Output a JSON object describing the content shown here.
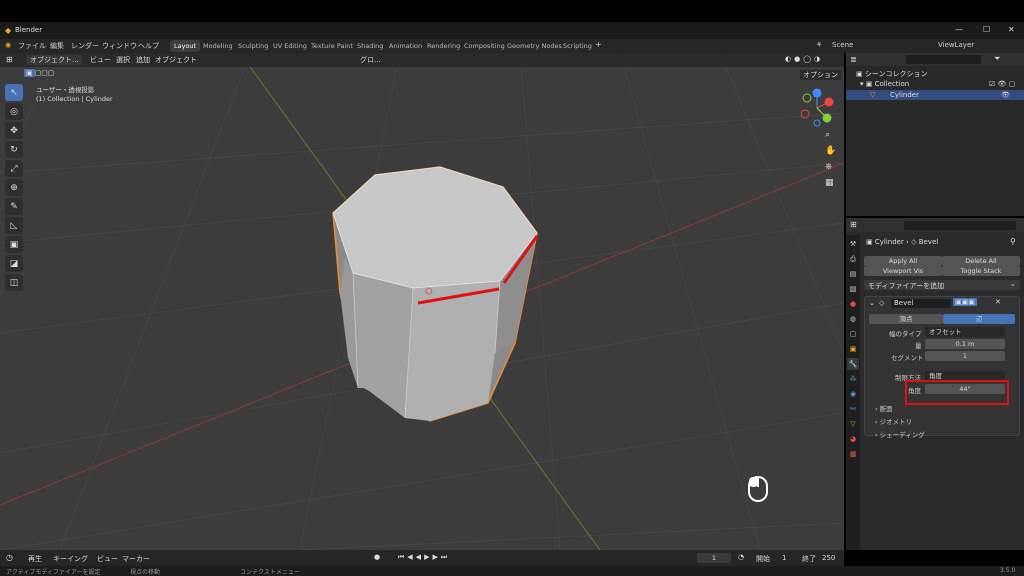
{
  "window": {
    "title": "Blender",
    "controls": [
      "—",
      "☐",
      "✕"
    ]
  },
  "menu": [
    "ファイル",
    "編集",
    "レンダー",
    "ウィンドウ",
    "ヘルプ"
  ],
  "workspaces": [
    "Layout",
    "Modeling",
    "Sculpting",
    "UV Editing",
    "Texture Paint",
    "Shading",
    "Animation",
    "Rendering",
    "Compositing",
    "Geometry Nodes",
    "Scripting"
  ],
  "scene": {
    "name": "Scene",
    "view_layer": "ViewLayer"
  },
  "viewport_header": {
    "mode": "オブジェクト...",
    "menus": [
      "ビュー",
      "選択",
      "追加",
      "オブジェクト"
    ],
    "transform": "グロ...",
    "options": "オプション"
  },
  "viewport_info": {
    "line1": "ユーザー・透視投影",
    "line2": "(1) Collection | Cylinder"
  },
  "outliner": {
    "root": "シーンコレクション",
    "collection": "Collection",
    "object": "Cylinder"
  },
  "properties": {
    "breadcrumb_object": "Cylinder",
    "breadcrumb_modifier": "Bevel",
    "apply_all": "Apply All",
    "delete_all": "Delete All",
    "viewport_vis": "Viewport Vis",
    "toggle_stack": "Toggle Stack",
    "add_modifier": "モディファイアーを追加",
    "modifier_name": "Bevel",
    "affect_vertices": "頂点",
    "affect_edges": "辺",
    "width_type_label": "幅のタイプ",
    "width_type_value": "オフセット",
    "amount_label": "量",
    "amount_value": "0.1 m",
    "segments_label": "セグメント",
    "segments_value": "1",
    "limit_method_label": "制限方法",
    "limit_method_value": "角度",
    "angle_label": "角度",
    "angle_value": "44°",
    "sections": [
      "断面",
      "ジオメトリ",
      "シェーディング"
    ]
  },
  "timeline": {
    "menus": [
      "再生",
      "キーイング",
      "ビュー",
      "マーカー"
    ],
    "current_frame": "1",
    "start_label": "開始",
    "start": "1",
    "end_label": "終了",
    "end": "250"
  },
  "status": {
    "left": "アクティブモディファイアーを設定",
    "mid": "視点の移動",
    "right": "コンテクストメニュー",
    "version": "3.5.0"
  },
  "colors": {
    "accent": "#4772b3",
    "highlight_red": "#e01010",
    "selection_orange": "#f28c28"
  }
}
